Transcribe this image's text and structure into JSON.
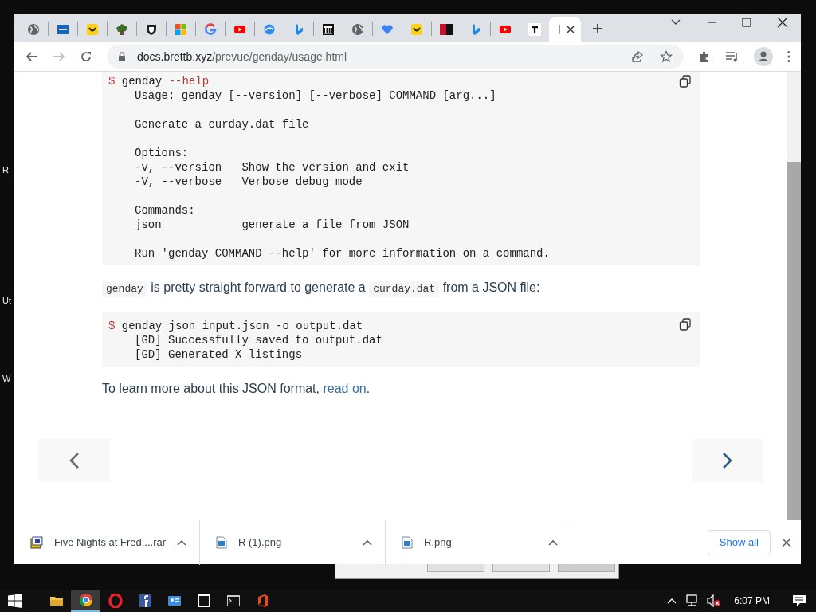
{
  "desktop_labels": [
    "R",
    "Ut",
    "W"
  ],
  "browser": {
    "tabs": [
      {
        "selected": false
      },
      {
        "selected": false
      },
      {
        "selected": false
      },
      {
        "selected": false
      },
      {
        "selected": false
      },
      {
        "selected": false
      },
      {
        "selected": false
      },
      {
        "selected": false
      },
      {
        "selected": false
      },
      {
        "selected": false
      },
      {
        "selected": false
      },
      {
        "selected": false
      },
      {
        "selected": false
      },
      {
        "selected": false
      },
      {
        "selected": false
      },
      {
        "selected": false
      },
      {
        "selected": false
      },
      {
        "selected": false
      },
      {
        "selected": true
      }
    ],
    "address": {
      "domain": "docs.brettb.xyz",
      "path": "/prevue/genday/usage.html"
    },
    "content": [
      {
        "kind": "code",
        "prompt": "$",
        "command": [
          {
            "text": "genday",
            "highlight": false
          },
          {
            "text": " --help",
            "highlight": true
          }
        ],
        "output": [
          [
            "Usage: genday [--version] [--verbose] COMMAND [arg...]"
          ],
          [
            "Generate a curday.dat file"
          ],
          [
            "Options:",
            "-v, --version   Show the version and exit",
            "-V, --verbose   Verbose debug mode"
          ],
          [
            "Commands:",
            "json            generate a file from JSON"
          ],
          [
            "Run 'genday COMMAND --help' for more information on a command."
          ]
        ]
      },
      {
        "kind": "paragraph",
        "parts": [
          {
            "kind": "code",
            "text": "genday"
          },
          {
            "kind": "text",
            "text": " is pretty straight forward to generate a "
          },
          {
            "kind": "code",
            "text": "curday.dat"
          },
          {
            "kind": "text",
            "text": " from a JSON file:"
          }
        ]
      },
      {
        "kind": "code",
        "prompt": "$",
        "command": [
          {
            "text": "genday json input.json -o output.dat",
            "highlight": false
          }
        ],
        "output": [
          [
            "[GD] Successfully saved to output.dat",
            "[GD] Generated X listings"
          ]
        ]
      },
      {
        "kind": "paragraph",
        "parts": [
          {
            "kind": "text",
            "text": "To learn more about this JSON format, "
          },
          {
            "kind": "link",
            "text": "read on"
          },
          {
            "kind": "text",
            "text": "."
          }
        ]
      }
    ],
    "downloads": [
      {
        "name": "Five Nights at Fred....rar",
        "kind": "archive"
      },
      {
        "name": "R (1).png",
        "kind": "image"
      },
      {
        "name": "R.png",
        "kind": "image"
      }
    ],
    "show_all": "Show all"
  },
  "taskbar": {
    "apps": [
      {
        "selected": false
      },
      {
        "selected": true
      },
      {
        "selected": false
      },
      {
        "selected": false
      },
      {
        "selected": false
      },
      {
        "selected": false
      },
      {
        "selected": false
      },
      {
        "selected": false
      }
    ],
    "clock": "6:07 PM"
  }
}
